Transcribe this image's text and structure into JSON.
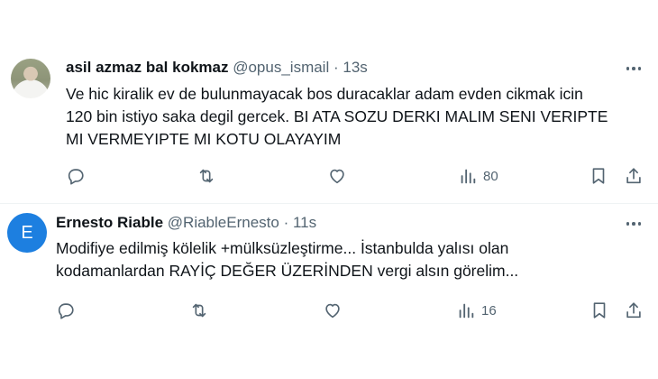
{
  "tweets": [
    {
      "avatar_letter": "",
      "display_name": "asil azmaz bal kokmaz",
      "handle": "@opus_ismail",
      "separator": "·",
      "time": "13s",
      "text": "Ve hic kiralik ev de bulunmayacak bos duracaklar adam evden cikmak icin\n120 bin istiyo saka degil gercek. BI ATA SOZU DERKI MALIM SENI VERIPTE\nMI VERMEYIPTE MI KOTU OLAYAYIM",
      "views": "80"
    },
    {
      "avatar_letter": "E",
      "display_name": "Ernesto Riable",
      "handle": "@RiableErnesto",
      "separator": "·",
      "time": "11s",
      "text": "Modifiye edilmiş kölelik +mülksüzleştirme... İstanbulda yalısı olan\nkodamanlardan RAYİÇ DEĞER ÜZERİNDEN vergi alsın görelim...",
      "views": "16"
    }
  ],
  "icons": [
    "reply-icon",
    "retweet-icon",
    "like-icon",
    "views-icon",
    "bookmark-icon",
    "share-icon",
    "more-icon"
  ],
  "colors": {
    "text": "#0f1419",
    "muted": "#536471",
    "avatar_blue": "#1d7fe0",
    "divider": "#eff3f4"
  }
}
